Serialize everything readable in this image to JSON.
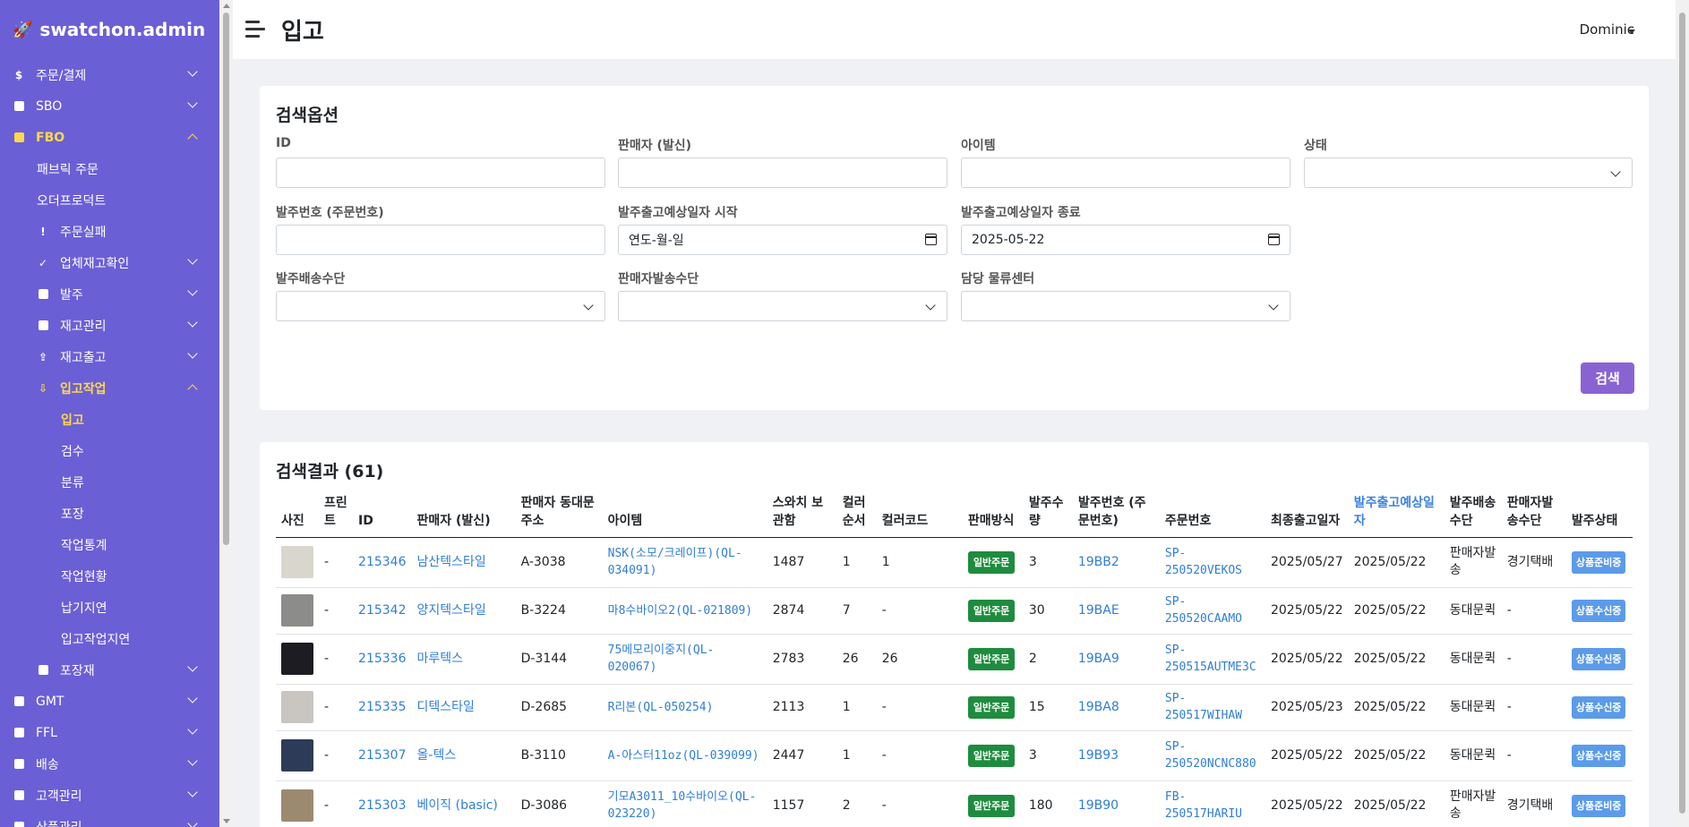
{
  "brand": "swatchon.admin",
  "header": {
    "title": "입고",
    "user": "Dominic"
  },
  "sidebar": {
    "items": [
      {
        "label": "주문/결제",
        "icon": "dollar-icon"
      },
      {
        "label": "SBO",
        "icon": "box-icon"
      },
      {
        "label": "FBO",
        "icon": "fabric-icon"
      },
      {
        "label": "패브릭 주문"
      },
      {
        "label": "오더프로덕트"
      },
      {
        "label": "주문실패",
        "icon": "exclamation-icon"
      },
      {
        "label": "업체재고확인",
        "icon": "check-icon"
      },
      {
        "label": "발주",
        "icon": "file-icon"
      },
      {
        "label": "재고관리",
        "icon": "warehouse-icon"
      },
      {
        "label": "재고출고",
        "icon": "upload-icon"
      },
      {
        "label": "입고작업",
        "icon": "download-icon"
      },
      {
        "label": "입고"
      },
      {
        "label": "검수"
      },
      {
        "label": "분류"
      },
      {
        "label": "포장"
      },
      {
        "label": "작업통계"
      },
      {
        "label": "작업현황"
      },
      {
        "label": "납기지연"
      },
      {
        "label": "입고작업지연"
      },
      {
        "label": "포장재",
        "icon": "box-icon"
      },
      {
        "label": "GMT",
        "icon": "shirt-icon"
      },
      {
        "label": "FFL",
        "icon": "industry-icon"
      },
      {
        "label": "배송",
        "icon": "truck-icon"
      },
      {
        "label": "고객관리",
        "icon": "users-icon"
      },
      {
        "label": "상품관리",
        "icon": "tag-icon"
      }
    ]
  },
  "search": {
    "title": "검색옵션",
    "labels": {
      "id": "ID",
      "seller": "판매자 (발신)",
      "item": "아이템",
      "status": "상태",
      "po_number": "발주번호 (주문번호)",
      "ship_start": "발주출고예상일자 시작",
      "ship_end": "발주출고예상일자 종료",
      "po_shipping": "발주배송수단",
      "seller_shipping": "판매자발송수단",
      "center": "담당 물류센터"
    },
    "values": {
      "ship_start": "연도-월-일",
      "ship_end": "2025-05-22"
    },
    "button": "검색"
  },
  "results": {
    "title": "검색결과 (61)",
    "columns": [
      "사진",
      "프린트",
      "ID",
      "판매자 (발신)",
      "판매자 동대문 주소",
      "아이템",
      "스와치 보관함",
      "컬러 순서",
      "컬러코드",
      "판매방식",
      "발주수량",
      "발주번호 (주문번호)",
      "주문번호",
      "최종출고일자",
      "발주출고예상일자",
      "발주배송수단",
      "판매자발송수단",
      "발주상태"
    ],
    "rows": [
      {
        "print": "-",
        "id": "215346",
        "seller": "남산텍스타일",
        "address": "A-3038",
        "item": "NSK(소모/크레이프)(QL-034091)",
        "box": "1487",
        "color_order": "1",
        "color_code": "1",
        "sale": "일반주문",
        "qty": "3",
        "po": "19BB2",
        "order": "SP-250520VEKOS",
        "last_ship": "2025/05/27",
        "expected": "2025/05/22",
        "po_ship": "판매자발송",
        "seller_ship": "경기택배",
        "status": "상품준비중"
      },
      {
        "print": "-",
        "id": "215342",
        "seller": "양지텍스타일",
        "address": "B-3224",
        "item": "마8수바이오2(QL-021809)",
        "box": "2874",
        "color_order": "7",
        "color_code": "-",
        "sale": "일반주문",
        "qty": "30",
        "po": "19BAE",
        "order": "SP-250520CAAMO",
        "last_ship": "2025/05/22",
        "expected": "2025/05/22",
        "po_ship": "동대문퀵",
        "seller_ship": "-",
        "status": "상품수신중"
      },
      {
        "print": "-",
        "id": "215336",
        "seller": "마루텍스",
        "address": "D-3144",
        "item": "75메모리이중지(QL-020067)",
        "box": "2783",
        "color_order": "26",
        "color_code": "26",
        "sale": "일반주문",
        "qty": "2",
        "po": "19BA9",
        "order": "SP-250515AUTME3C",
        "last_ship": "2025/05/22",
        "expected": "2025/05/22",
        "po_ship": "동대문퀵",
        "seller_ship": "-",
        "status": "상품수신중"
      },
      {
        "print": "-",
        "id": "215335",
        "seller": "디텍스타일",
        "address": "D-2685",
        "item": "R리본(QL-050254)",
        "box": "2113",
        "color_order": "1",
        "color_code": "-",
        "sale": "일반주문",
        "qty": "15",
        "po": "19BA8",
        "order": "SP-250517WIHAW",
        "last_ship": "2025/05/23",
        "expected": "2025/05/22",
        "po_ship": "동대문퀵",
        "seller_ship": "-",
        "status": "상품수신중"
      },
      {
        "print": "-",
        "id": "215307",
        "seller": "올-텍스",
        "address": "B-3110",
        "item": "A-아스터11oz(QL-039099)",
        "box": "2447",
        "color_order": "1",
        "color_code": "-",
        "sale": "일반주문",
        "qty": "3",
        "po": "19B93",
        "order": "SP-250520NCNC880",
        "last_ship": "2025/05/22",
        "expected": "2025/05/22",
        "po_ship": "동대문퀵",
        "seller_ship": "-",
        "status": "상품수신중"
      },
      {
        "print": "-",
        "id": "215303",
        "seller": "베이직 (basic)",
        "address": "D-3086",
        "item": "기모A3011_10수바이오(QL-023220)",
        "box": "1157",
        "color_order": "2",
        "color_code": "-",
        "sale": "일반주문",
        "qty": "180",
        "po": "19B90",
        "order": "FB-250517HARIU",
        "last_ship": "2025/05/22",
        "expected": "2025/05/22",
        "po_ship": "판매자발송",
        "seller_ship": "경기택배",
        "status": "상품준비중"
      }
    ]
  },
  "colors": {
    "sidebar": "#6b5fd6",
    "active": "#ffd84a",
    "button": "#8a63d2",
    "badge_green": "#1e8c3e",
    "badge_blue": "#5b9bea",
    "link": "#2f7ed8"
  },
  "thumbs": [
    "#d9d6ce",
    "#8c8c8a",
    "#1c1c22",
    "#c9c6c2",
    "#2d3b58",
    "#9b8a70"
  ]
}
